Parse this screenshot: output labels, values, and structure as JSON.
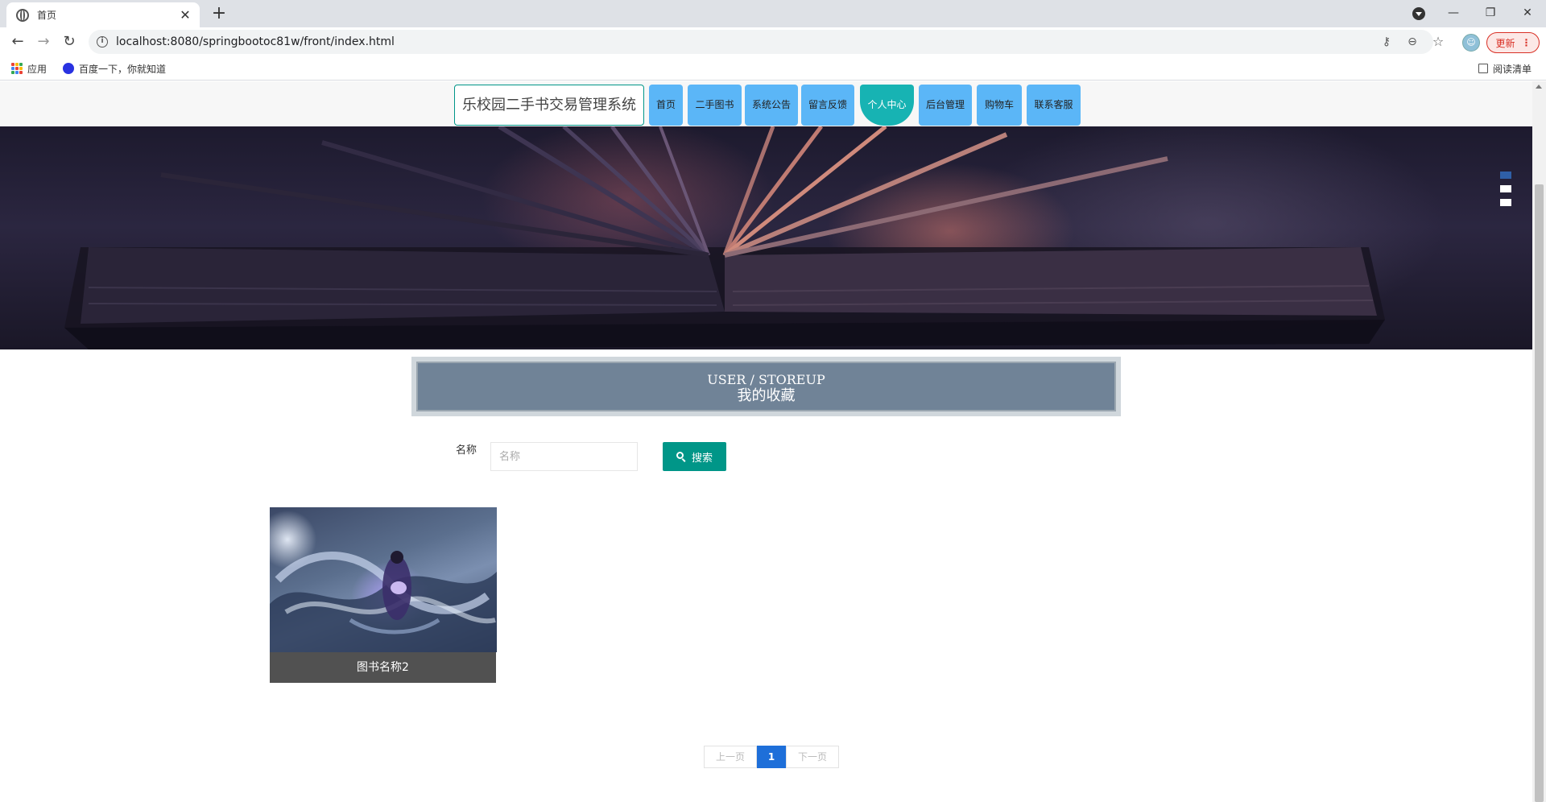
{
  "browser": {
    "tab_title": "首页",
    "url": "localhost:8080/springbootoc81w/front/index.html",
    "update_label": "更新",
    "bookmarks": {
      "apps": "应用",
      "baidu": "百度一下，你就知道",
      "reading_list": "阅读清单"
    }
  },
  "header": {
    "site_title": "乐校园二手书交易管理系统",
    "nav": [
      {
        "label": "首页"
      },
      {
        "label": "二手图书"
      },
      {
        "label": "系统公告"
      },
      {
        "label": "留言反馈"
      },
      {
        "label": "个人中心",
        "active": true
      },
      {
        "label": "后台管理"
      },
      {
        "label": "购物车"
      },
      {
        "label": "联系客服"
      }
    ]
  },
  "banner": {
    "slide_count": 3,
    "active_slide": 1
  },
  "section": {
    "title_en": "USER / STOREUP",
    "title_cn": "我的收藏"
  },
  "search": {
    "label": "名称",
    "placeholder": "名称",
    "value": "",
    "button_label": "搜索"
  },
  "items": [
    {
      "name": "图书名称2"
    }
  ],
  "pagination": {
    "prev_label": "上一页",
    "current": "1",
    "next_label": "下一页"
  },
  "colors": {
    "accent": "#009688",
    "nav_bg": "#5bb6f7",
    "nav_active": "#17b3b3",
    "title_box": "#708397",
    "pager_current": "#1e6fd9"
  }
}
